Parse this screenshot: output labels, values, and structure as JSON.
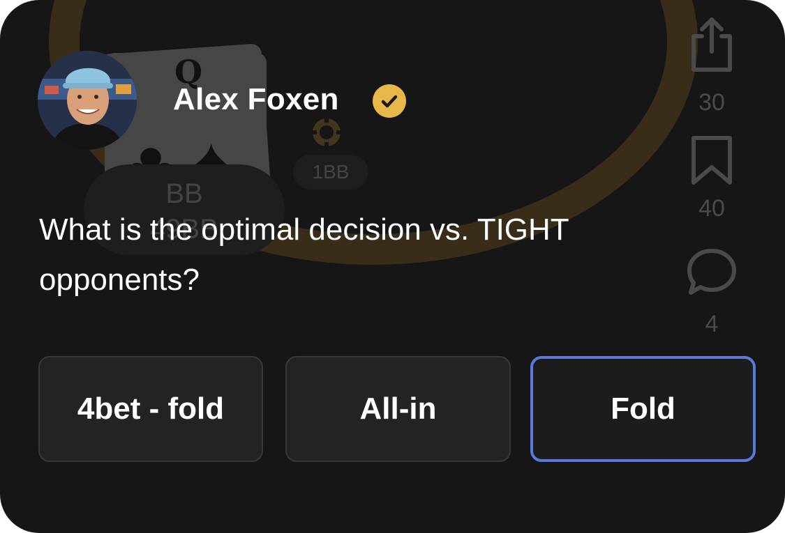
{
  "background": {
    "card_rank": "Q",
    "card_suits": "spades-icon",
    "player_position": "BB",
    "player_stack": "49BB",
    "chip_amount": "1BB",
    "table_color": "#b47a22"
  },
  "author": {
    "name": "Alex Foxen",
    "verified": true,
    "verified_color": "#e7b74a"
  },
  "actions": {
    "share": {
      "icon": "share-icon",
      "count": "30"
    },
    "bookmark": {
      "icon": "bookmark-icon",
      "count": "40"
    },
    "comment": {
      "icon": "comment-icon",
      "count": "4"
    }
  },
  "question": {
    "text": "What is the optimal decision vs. TIGHT opponents?"
  },
  "answers": [
    {
      "label": "4bet - fold",
      "selected": false
    },
    {
      "label": "All-in",
      "selected": false
    },
    {
      "label": "Fold",
      "selected": true
    }
  ],
  "colors": {
    "card_background": "#161616",
    "button_background": "#232323",
    "selected_border": "#5b78dc"
  }
}
